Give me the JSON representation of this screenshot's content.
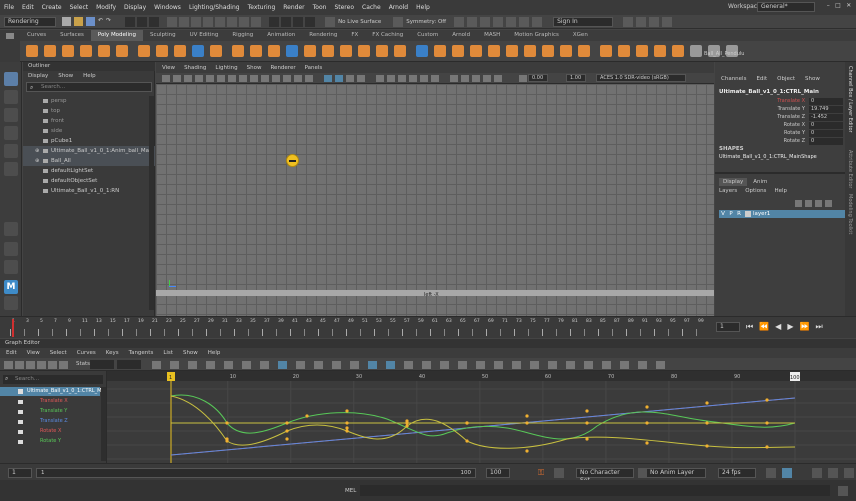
{
  "menubar": {
    "items": [
      "File",
      "Edit",
      "Create",
      "Select",
      "Modify",
      "Display",
      "Windows",
      "Lighting/Shading",
      "Texturing",
      "Render",
      "Toon",
      "Stereo",
      "Cache",
      "Arnold",
      "Help"
    ],
    "workspace_label": "Workspace:",
    "workspace_value": "General*"
  },
  "toolbar": {
    "mode": "Rendering",
    "live_surface": "No Live Surface",
    "symmetry": "Symmetry: Off",
    "sign_in": "Sign In"
  },
  "shelf": {
    "tabs": [
      "Curves",
      "Surfaces",
      "Poly Modeling",
      "Sculpting",
      "UV Editing",
      "Rigging",
      "Animation",
      "Rendering",
      "FX",
      "FX Caching",
      "Custom",
      "Arnold",
      "MASH",
      "Motion Graphics",
      "XGen"
    ],
    "active_tab": "Poly Modeling",
    "custom_label": "Ball_All_Pendulu"
  },
  "outliner": {
    "title": "Outliner",
    "menu": [
      "Display",
      "Show",
      "Help"
    ],
    "search_placeholder": "Search...",
    "items": [
      "persp",
      "top",
      "front",
      "side",
      "pCube1",
      "Ultimate_Ball_v1_0_1:Anim_ball_Main",
      "Ball_All",
      "defaultLightSet",
      "defaultObjectSet",
      "Ultimate_Ball_v1_0_1:RN"
    ],
    "selected_indices": [
      5,
      6
    ]
  },
  "viewport": {
    "menu": [
      "View",
      "Shading",
      "Lighting",
      "Show",
      "Renderer",
      "Panels"
    ],
    "field1": "0.00",
    "field2": "1.00",
    "colorspace": "ACES 1.0 SDR-video (sRGB)",
    "camera_label": "left -X"
  },
  "channelbox": {
    "menu": [
      "Channels",
      "Edit",
      "Object",
      "Show"
    ],
    "object_name": "Ultimate_Ball_v1_0_1:CTRL_Main",
    "attributes": [
      {
        "name": "Translate X",
        "value": "0",
        "color": "#d05050"
      },
      {
        "name": "Translate Y",
        "value": "19.749",
        "color": "#ccc"
      },
      {
        "name": "Translate Z",
        "value": "-1.452",
        "color": "#ccc"
      },
      {
        "name": "Rotate X",
        "value": "0",
        "color": "#ccc"
      },
      {
        "name": "Rotate Y",
        "value": "0",
        "color": "#ccc"
      },
      {
        "name": "Rotate Z",
        "value": "0",
        "color": "#ccc"
      }
    ],
    "shapes_title": "SHAPES",
    "shape_name": "Ultimate_Ball_v1_0_1:CTRL_MainShape",
    "layer_tabs": [
      "Display",
      "Anim"
    ],
    "layer_menu": [
      "Layers",
      "Options",
      "Help"
    ],
    "layer": {
      "v": "V",
      "p": "P",
      "r": "R",
      "name": "layer1"
    }
  },
  "side_tabs": [
    "Channel Box / Layer Editor",
    "Attribute Editor",
    "Modeling Toolkit"
  ],
  "timeslider": {
    "ticks": [
      "1",
      "3",
      "5",
      "7",
      "9",
      "11",
      "13",
      "15",
      "17",
      "19",
      "21",
      "23",
      "25",
      "27",
      "29",
      "31",
      "33",
      "35",
      "37",
      "39",
      "41",
      "43",
      "45",
      "47",
      "49",
      "51",
      "53",
      "55",
      "57",
      "59",
      "61",
      "63",
      "65",
      "67",
      "69",
      "71",
      "73",
      "75",
      "77",
      "79",
      "81",
      "83",
      "85",
      "87",
      "89",
      "91",
      "93",
      "95",
      "97",
      "99"
    ],
    "current_frame": "1"
  },
  "graph_editor": {
    "title": "Graph Editor",
    "menu": [
      "Edit",
      "View",
      "Select",
      "Curves",
      "Keys",
      "Tangents",
      "List",
      "Show",
      "Help"
    ],
    "stats_label": "Stats",
    "search_placeholder": "Search...",
    "node": "Ultimate_Ball_v1_0_1:CTRL_Ma",
    "channels": [
      {
        "name": "Translate X",
        "color": "#e05858"
      },
      {
        "name": "Translate Y",
        "color": "#58c858"
      },
      {
        "name": "Translate Z",
        "color": "#5a8ae0"
      },
      {
        "name": "Rotate X",
        "color": "#e05858"
      },
      {
        "name": "Rotate Y",
        "color": "#58c858"
      }
    ],
    "frame_labels": [
      "1",
      "10",
      "20",
      "30",
      "40",
      "50",
      "60",
      "70",
      "80",
      "90",
      "100"
    ],
    "current_frame_label": "1",
    "end_frame_label": "100"
  },
  "range": {
    "start": "1",
    "inner_start": "1",
    "inner_end": "100",
    "end": "100",
    "fps": "24 fps",
    "character_set": "No Character Set",
    "anim_layer": "No Anim Layer"
  },
  "cmdline": {
    "label": "MEL"
  }
}
